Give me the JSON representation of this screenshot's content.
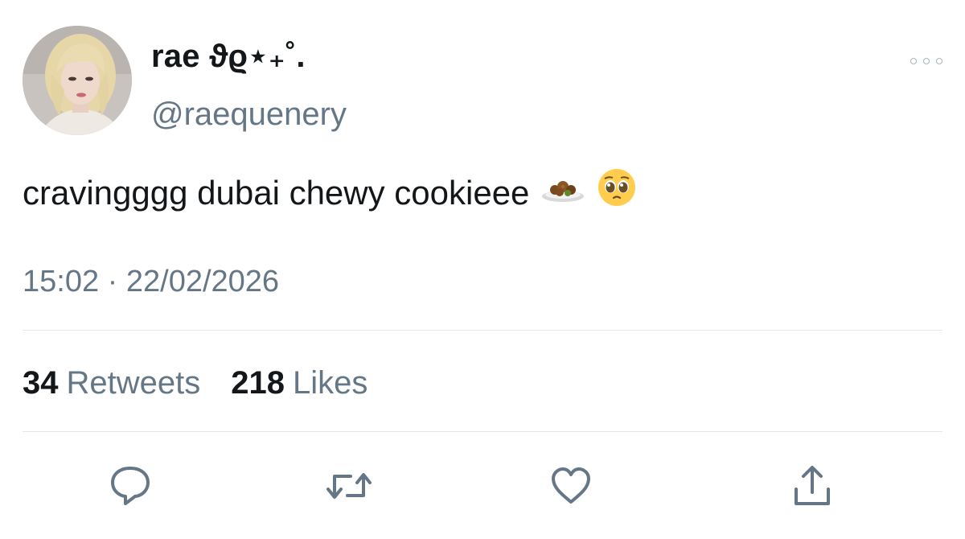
{
  "tweet": {
    "display_name": "rae ϑϱ⋆₊˚.",
    "handle": "@raequenery",
    "text": "cravingggg dubai chewy cookieee",
    "emojis": [
      "falafel-plate-emoji",
      "pleading-face-emoji"
    ],
    "time": "15:02",
    "separator": "·",
    "date": "22/02/2026"
  },
  "stats": {
    "retweets_count": "34",
    "retweets_label": "Retweets",
    "likes_count": "218",
    "likes_label": "Likes"
  },
  "actions": {
    "icons": [
      "reply-icon",
      "retweet-icon",
      "like-heart-icon",
      "share-icon"
    ]
  },
  "colors": {
    "text_primary": "#14171a",
    "text_secondary": "#657786",
    "divider": "#e1e8ed",
    "icon": "#657786"
  }
}
